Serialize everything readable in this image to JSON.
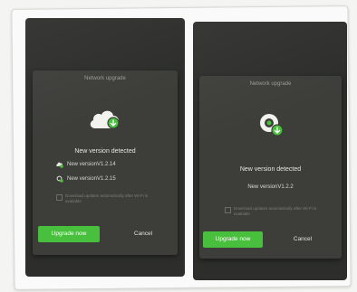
{
  "colors": {
    "accent_green": "#49c03d",
    "dialog_bg": "#3d3e3a",
    "screen_bg": "#2d2e2b"
  },
  "screens": [
    {
      "dialog": {
        "title": "Network upgrade",
        "icon": "cloud-download-icon",
        "message": "New version detected",
        "versions": [
          {
            "icon": "install-badge-icon",
            "label": "New versionV1.2.14"
          },
          {
            "icon": "search-badge-icon",
            "label": "New versionV1.2.15"
          }
        ],
        "note": "Download updates automatically after Wi-Fi is available",
        "primary_button": "Upgrade now",
        "cancel_button": "Cancel"
      }
    },
    {
      "dialog": {
        "title": "Network upgrade",
        "icon": "install-badge-icon",
        "message": "New version detected",
        "versions": [
          {
            "label": "New versionV1.2.2"
          }
        ],
        "note": "Download updates automatically after Wi-Fi is available",
        "primary_button": "Upgrade now",
        "cancel_button": "Cancel"
      }
    }
  ]
}
